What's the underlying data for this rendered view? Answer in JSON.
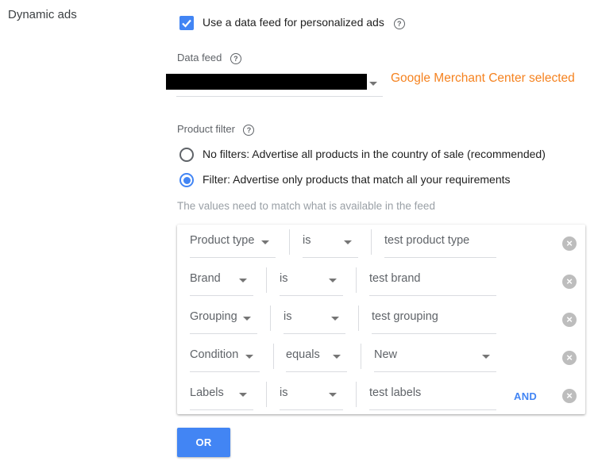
{
  "section": {
    "title": "Dynamic ads"
  },
  "feed_option": {
    "checked": true,
    "label": "Use a data feed for personalized ads"
  },
  "data_feed": {
    "label": "Data feed",
    "annotation": "Google Merchant Center selected"
  },
  "product_filter": {
    "label": "Product filter",
    "options": [
      {
        "label": "No filters: Advertise all products in the country of sale (recommended)",
        "selected": false
      },
      {
        "label": "Filter: Advertise only products that match all your requirements",
        "selected": true
      }
    ],
    "hint": "The values need to match what is available in the feed"
  },
  "filters": {
    "rows": [
      {
        "attribute": "Product type",
        "operator": "is",
        "value": "test product type"
      },
      {
        "attribute": "Brand",
        "operator": "is",
        "value": "test brand"
      },
      {
        "attribute": "Grouping",
        "operator": "is",
        "value": "test grouping"
      },
      {
        "attribute": "Condition",
        "operator": "equals",
        "value": "New"
      },
      {
        "attribute": "Labels",
        "operator": "is",
        "value": "test labels"
      }
    ],
    "and_label": "AND",
    "or_label": "OR"
  },
  "colors": {
    "accent": "#4285f4",
    "annotation": "#f5821f"
  }
}
